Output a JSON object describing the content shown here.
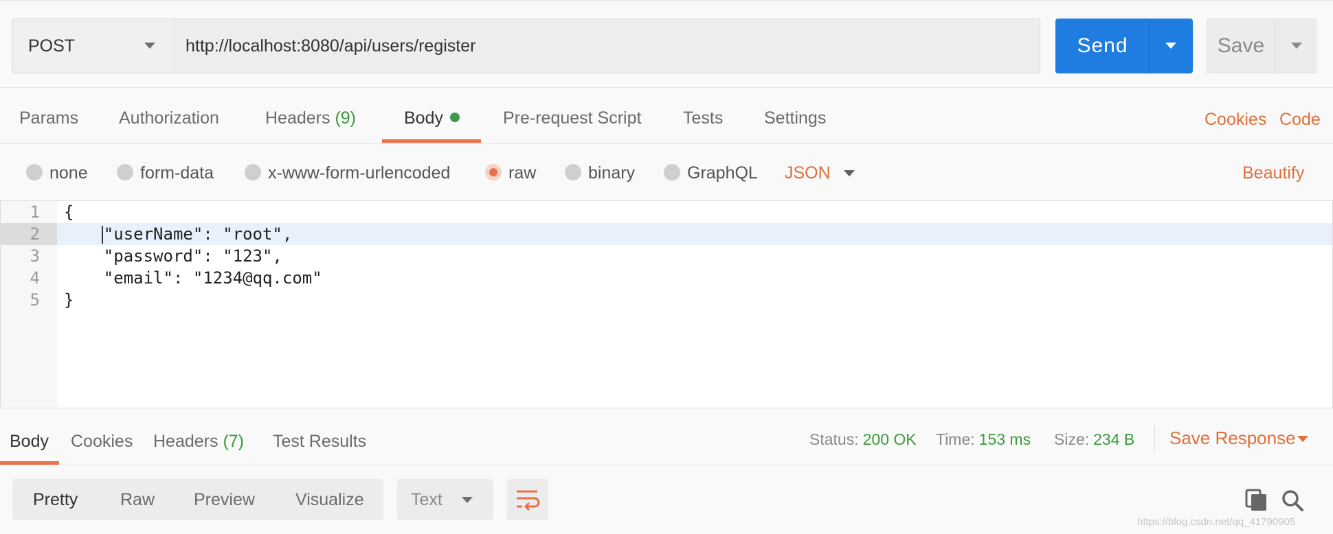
{
  "request": {
    "method": "POST",
    "url": "http://localhost:8080/api/users/register",
    "send_label": "Send",
    "save_label": "Save"
  },
  "request_tabs": {
    "params": "Params",
    "authorization": "Authorization",
    "headers": "Headers",
    "headers_count": "(9)",
    "body": "Body",
    "prerequest": "Pre-request Script",
    "tests": "Tests",
    "settings": "Settings",
    "cookies": "Cookies",
    "code": "Code"
  },
  "body_types": {
    "none": "none",
    "form_data": "form-data",
    "urlencoded": "x-www-form-urlencoded",
    "raw": "raw",
    "binary": "binary",
    "graphql": "GraphQL",
    "format": "JSON",
    "beautify": "Beautify",
    "selected": "raw"
  },
  "editor": {
    "line_numbers": [
      "1",
      "2",
      "3",
      "4",
      "5"
    ],
    "lines": [
      "{",
      "    \"userName\": \"root\",",
      "    \"password\": \"123\",",
      "    \"email\": \"1234@qq.com\"",
      "}"
    ]
  },
  "response_tabs": {
    "body": "Body",
    "cookies": "Cookies",
    "headers": "Headers",
    "headers_count": "(7)",
    "test_results": "Test Results"
  },
  "response_stats": {
    "status_label": "Status:",
    "status_value": "200 OK",
    "time_label": "Time:",
    "time_value": "153 ms",
    "size_label": "Size:",
    "size_value": "234 B",
    "save_response": "Save Response"
  },
  "view_modes": {
    "pretty": "Pretty",
    "raw": "Raw",
    "preview": "Preview",
    "visualize": "Visualize",
    "text_format": "Text"
  },
  "watermark": "https://blog.csdn.net/qq_41790905",
  "colors": {
    "accent": "#e8704a",
    "send_blue": "#1f7ce0",
    "success_green": "#3c9a3c"
  }
}
